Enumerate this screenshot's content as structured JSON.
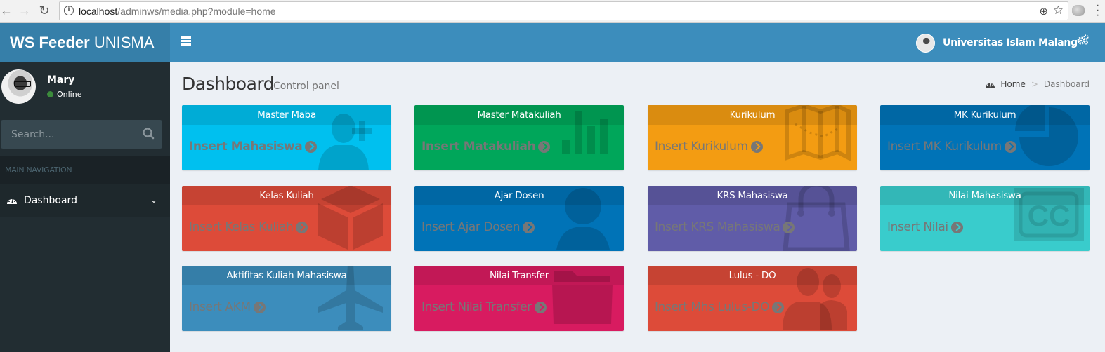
{
  "browser": {
    "url_host": "localhost",
    "url_path": "/adminws/media.php?module=home"
  },
  "header": {
    "logo_bold": "WS Feeder",
    "logo_light": " UNISMA",
    "user_name": "Universitas Islam Malang"
  },
  "sidebar": {
    "user": {
      "name": "Mary",
      "status": "Online"
    },
    "search": {
      "placeholder": "Search..."
    },
    "nav_header": "MAIN NAVIGATION",
    "items": [
      {
        "label": "Dashboard",
        "icon": "dashboard-icon"
      }
    ]
  },
  "content": {
    "title": "Dashboard",
    "subtitle": "Control panel",
    "breadcrumb": {
      "home": "Home",
      "current": "Dashboard"
    }
  },
  "boxes": [
    {
      "title": "Master Maba",
      "link": "Insert Mahasiswa",
      "icon": "user-plus-icon",
      "color": "#00c0ef"
    },
    {
      "title": "Master Matakuliah",
      "link": "Insert Matakuliah",
      "icon": "bar-chart-icon",
      "color": "#00a65a"
    },
    {
      "title": "Kurikulum",
      "link": "Insert Kurikulum",
      "icon": "map-icon",
      "color": "#f39c12"
    },
    {
      "title": "MK Kurikulum",
      "link": "Insert MK Kurikulum",
      "icon": "pie-chart-icon",
      "color": "#0073b7"
    },
    {
      "title": "Kelas Kuliah",
      "link": "Insert Kelas Kuliah",
      "icon": "cube-icon",
      "color": "#dd4b39"
    },
    {
      "title": "Ajar Dosen",
      "link": "Insert Ajar Dosen",
      "icon": "user-icon",
      "color": "#0073b7"
    },
    {
      "title": "KRS Mahasiswa",
      "link": "Insert KRS Mahasiswa",
      "icon": "shopping-bag-icon",
      "color": "#605ca8"
    },
    {
      "title": "Nilai Mahasiswa",
      "link": "Insert Nilai",
      "icon": "closed-caption-icon",
      "color": "#39cccc"
    },
    {
      "title": "Aktifitas Kuliah Mahasiswa",
      "link": "Insert AKM",
      "icon": "plane-icon",
      "color": "#3c8dbc"
    },
    {
      "title": "Nilai Transfer",
      "link": "Insert Nilai Transfer",
      "icon": "folder-icon",
      "color": "#d81b60"
    },
    {
      "title": "Lulus - DO",
      "link": "Insert Mhs Lulus-DO",
      "icon": "users-icon",
      "color": "#dd4b39"
    }
  ]
}
